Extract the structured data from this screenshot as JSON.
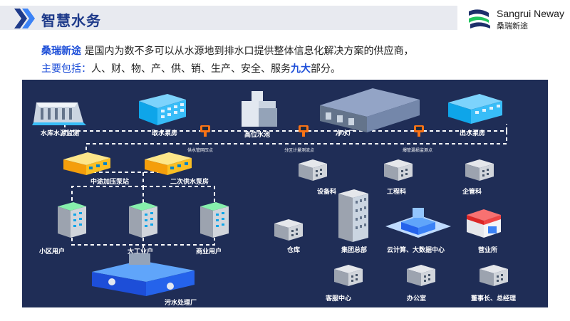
{
  "header": {
    "title": "智慧水务",
    "logo_en": "Sangrui Neway",
    "logo_cn": "桑瑞新途"
  },
  "intro": {
    "brand": "桑瑞新途",
    "line1_rest": "是国内为数不多可以从水源地到排水口提供整体信息化解决方案的供应商，",
    "line2_prefix": "主要包括：",
    "line2_items": "人、财、物、产、供、销、生产、安全、服务",
    "line2_emph": "九大",
    "line2_suffix": "部分。"
  },
  "diagram": {
    "nodes": {
      "reservoir": "水库水源监测",
      "intake": "取水泵房",
      "high_tank": "高位水池",
      "purify": "净水厂",
      "outlet": "出水泵房",
      "booster": "中途加压泵站",
      "secondary": "二次供水泵房",
      "residential": "小区用户",
      "industrial": "大工业户",
      "commercial": "商业用户",
      "sewage": "污水处理厂",
      "equipment": "设备科",
      "engineering": "工程科",
      "enterprise": "企管科",
      "warehouse": "仓库",
      "hq": "集团总部",
      "cloud": "云计算、大数据中心",
      "business": "营业所",
      "service": "客服中心",
      "office": "办公室",
      "chairman": "董事长、总经理"
    },
    "sensors": {
      "s1": "供水管网压点",
      "s2": "分区计量测流点",
      "s3": "爆管漏损监测点"
    }
  }
}
